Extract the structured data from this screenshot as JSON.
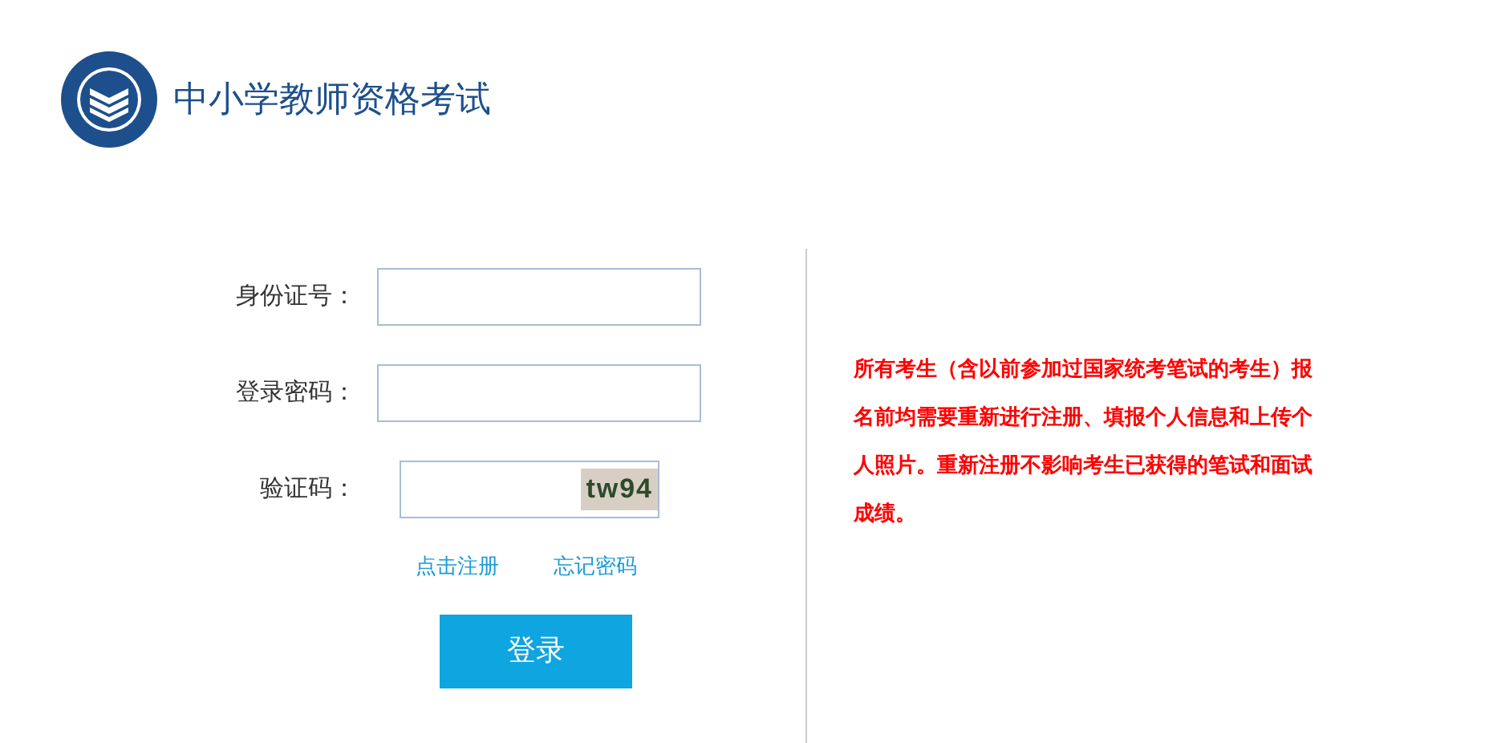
{
  "header": {
    "title": "中小学教师资格考试"
  },
  "form": {
    "fields": [
      {
        "kind": "text",
        "label": "身份证号："
      },
      {
        "kind": "password",
        "label": "登录密码："
      },
      {
        "kind": "captcha",
        "label": "验证码：",
        "captcha": "tw94"
      }
    ],
    "links": [
      "点击注册",
      "忘记密码"
    ],
    "submit": "登录"
  },
  "notice": "所有考生（含以前参加过国家统考笔试的考生）报名前均需要重新进行注册、填报个人信息和上传个人照片。重新注册不影响考生已获得的笔试和面试成绩。"
}
